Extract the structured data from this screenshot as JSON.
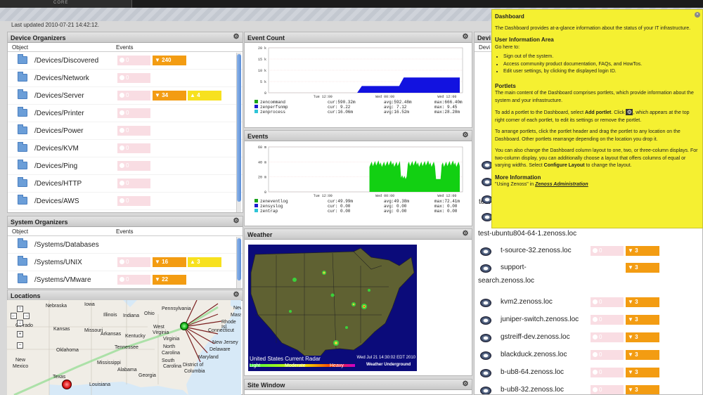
{
  "updated": "Last updated 2010-07-21 14:42:12.",
  "logo_sub": "CORE",
  "device_organizers": {
    "title": "Device Organizers",
    "col_object": "Object",
    "col_events": "Events",
    "rows": [
      {
        "label": "/Devices/Discovered",
        "red": "0",
        "orange": "240",
        "yellow": ""
      },
      {
        "label": "/Devices/Network",
        "red": "0",
        "orange": "",
        "yellow": ""
      },
      {
        "label": "/Devices/Server",
        "red": "0",
        "orange": "34",
        "yellow": "4"
      },
      {
        "label": "/Devices/Printer",
        "red": "0",
        "orange": "",
        "yellow": ""
      },
      {
        "label": "/Devices/Power",
        "red": "0",
        "orange": "",
        "yellow": ""
      },
      {
        "label": "/Devices/KVM",
        "red": "0",
        "orange": "",
        "yellow": ""
      },
      {
        "label": "/Devices/Ping",
        "red": "0",
        "orange": "",
        "yellow": ""
      },
      {
        "label": "/Devices/HTTP",
        "red": "0",
        "orange": "",
        "yellow": ""
      },
      {
        "label": "/Devices/AWS",
        "red": "0",
        "orange": "",
        "yellow": ""
      }
    ]
  },
  "system_organizers": {
    "title": "System Organizers",
    "col_object": "Object",
    "col_events": "Events",
    "rows": [
      {
        "label": "/Systems/Databases",
        "red": "",
        "orange": "",
        "yellow": ""
      },
      {
        "label": "/Systems/UNIX",
        "red": "0",
        "orange": "16",
        "yellow": "3"
      },
      {
        "label": "/Systems/VMware",
        "red": "0",
        "orange": "22",
        "yellow": ""
      }
    ]
  },
  "locations": {
    "title": "Locations",
    "places": [
      "Nebraska",
      "Iowa",
      "Illinois",
      "Indiana",
      "Ohio",
      "Pennsylvania",
      "New",
      "Massa",
      "Rhode Isl",
      "Connecticut",
      "New Jersey",
      "Delaware",
      "Maryland",
      "District of",
      "Columbia",
      "Virginia",
      "West",
      "Virginia",
      "Kentucky",
      "Tennessee",
      "North",
      "Carolina",
      "South",
      "Carolina",
      "Georgia",
      "Alabama",
      "Mississippi",
      "Louisiana",
      "Texas",
      "Oklahoma",
      "Arkansas",
      "Missouri",
      "Kansas",
      "New",
      "Mexico",
      "Co rado"
    ]
  },
  "event_count": {
    "title": "Event Count",
    "chart_data": {
      "type": "area",
      "y_ticks": [
        "20 k",
        "15 k",
        "10 k",
        "5 k",
        "0"
      ],
      "x_ticks": [
        "Tue 12:00",
        "Wed 00:00",
        "Wed 12:00"
      ],
      "ylim": [
        0,
        20000
      ],
      "series_values": [
        [
          0,
          0,
          0,
          0,
          0,
          0,
          0,
          0,
          0,
          0,
          0,
          0,
          0,
          0,
          0,
          0,
          0,
          0,
          0,
          0,
          3000,
          3000,
          3000,
          3000,
          3000,
          3000,
          3000,
          3000,
          3000,
          6800,
          6800,
          6800,
          6800,
          6800,
          6800,
          6800,
          6800,
          6800,
          6800,
          6800,
          6800,
          6800
        ]
      ],
      "legend": [
        {
          "name": "zencommand",
          "color": "#1aa31a",
          "cur": "cur:590.32m",
          "avg": "avg:592.48m",
          "max": "max:666.40m"
        },
        {
          "name": "zenperfsnmp",
          "color": "#1c1cd0",
          "cur": "cur: 9.22",
          "avg": "avg: 7.12",
          "max": "max: 9.45"
        },
        {
          "name": "zenprocess",
          "color": "#2ec4d8",
          "cur": "cur:16.06m",
          "avg": "avg:16.52m",
          "max": "max:28.20m"
        }
      ]
    }
  },
  "events": {
    "title": "Events",
    "chart_data": {
      "type": "area",
      "y_ticks": [
        "60 m",
        "40 m",
        "20 m",
        "0"
      ],
      "x_ticks": [
        "Tue 12:00",
        "Wed 00:00",
        "Wed 12:00"
      ],
      "ylim": [
        0,
        70
      ],
      "legend": [
        {
          "name": "zeneventlog",
          "color": "#1aa31a",
          "cur": "cur:49.99m",
          "avg": "avg:49.38m",
          "max": "max:72.41m"
        },
        {
          "name": "zensyslog",
          "color": "#1c1cd0",
          "cur": "cur: 0.00",
          "avg": "avg: 0.00",
          "max": "max: 0.00"
        },
        {
          "name": "zentrap",
          "color": "#2ec4d8",
          "cur": "cur: 0.00",
          "avg": "avg: 0.00",
          "max": "max: 0.00"
        }
      ]
    }
  },
  "weather": {
    "title": "Weather",
    "caption": "United States Current Radar",
    "timestamp": "Wed Jul 21 14:30:02 EDT 2010",
    "scale": [
      "Light",
      "Moderate",
      "Heavy"
    ],
    "brand": "Weather Underground"
  },
  "site_window": {
    "title": "Site Window"
  },
  "devices": {
    "title": "Devi",
    "header_partial": "Devi",
    "rows": [
      {
        "name": "test-",
        "red": "",
        "orange": ""
      },
      {
        "name": "test-ubuntu804-64-1.zenoss.loc",
        "red": "",
        "orange": ""
      },
      {
        "name": "t-source-32.zenoss.loc",
        "red": "0",
        "orange": "3"
      },
      {
        "name": "support-",
        "name2": "search.zenoss.loc",
        "red": "",
        "orange": "3"
      },
      {
        "name": "kvm2.zenoss.loc",
        "red": "0",
        "orange": "3"
      },
      {
        "name": "juniper-switch.zenoss.loc",
        "red": "0",
        "orange": "3"
      },
      {
        "name": "gstreiff-dev.zenoss.loc",
        "red": "0",
        "orange": "3"
      },
      {
        "name": "blackduck.zenoss.loc",
        "red": "0",
        "orange": "3"
      },
      {
        "name": "b-ub8-64.zenoss.loc",
        "red": "0",
        "orange": "3"
      },
      {
        "name": "b-ub8-32.zenoss.loc",
        "red": "0",
        "orange": "3"
      }
    ]
  },
  "help": {
    "title": "Dashboard",
    "intro": "The Dashboard provides at-a-glance information about the status of your IT infrastructure.",
    "h_user": "User Information Area",
    "go_here": "Go here to:",
    "bullets": [
      "Sign out of the system.",
      "Access community product documentation, FAQs, and HowTos.",
      "Edit user settings, by clicking the displayed login ID."
    ],
    "h_portlets": "Portlets",
    "p1": "The main content of the Dashboard comprises portlets, which provide information about the system and your infrastructure.",
    "p2a": "To add a portlet to the Dashboard, select ",
    "p2b": "Add portlet",
    "p2c": ". Click ",
    "p2d": ", which appears at the top right corner of each portlet, to edit its settings or remove the portlet.",
    "p3": "To arrange portlets, click the portlet header and drag the portlet to any location on the Dashboard. Other portlets rearrange depending on the location you drop it.",
    "p4a": "You can also change the Dashboard column layout to one, two, or three-column displays. For two-column display, you can additionally choose a layout that offers columns of equal or varying widths. Select ",
    "p4b": "Configure Layout",
    "p4c": " to change the layout.",
    "h_more": "More Information",
    "more_a": "\"Using Zenoss\" in ",
    "more_b": "Zenoss Administration"
  }
}
